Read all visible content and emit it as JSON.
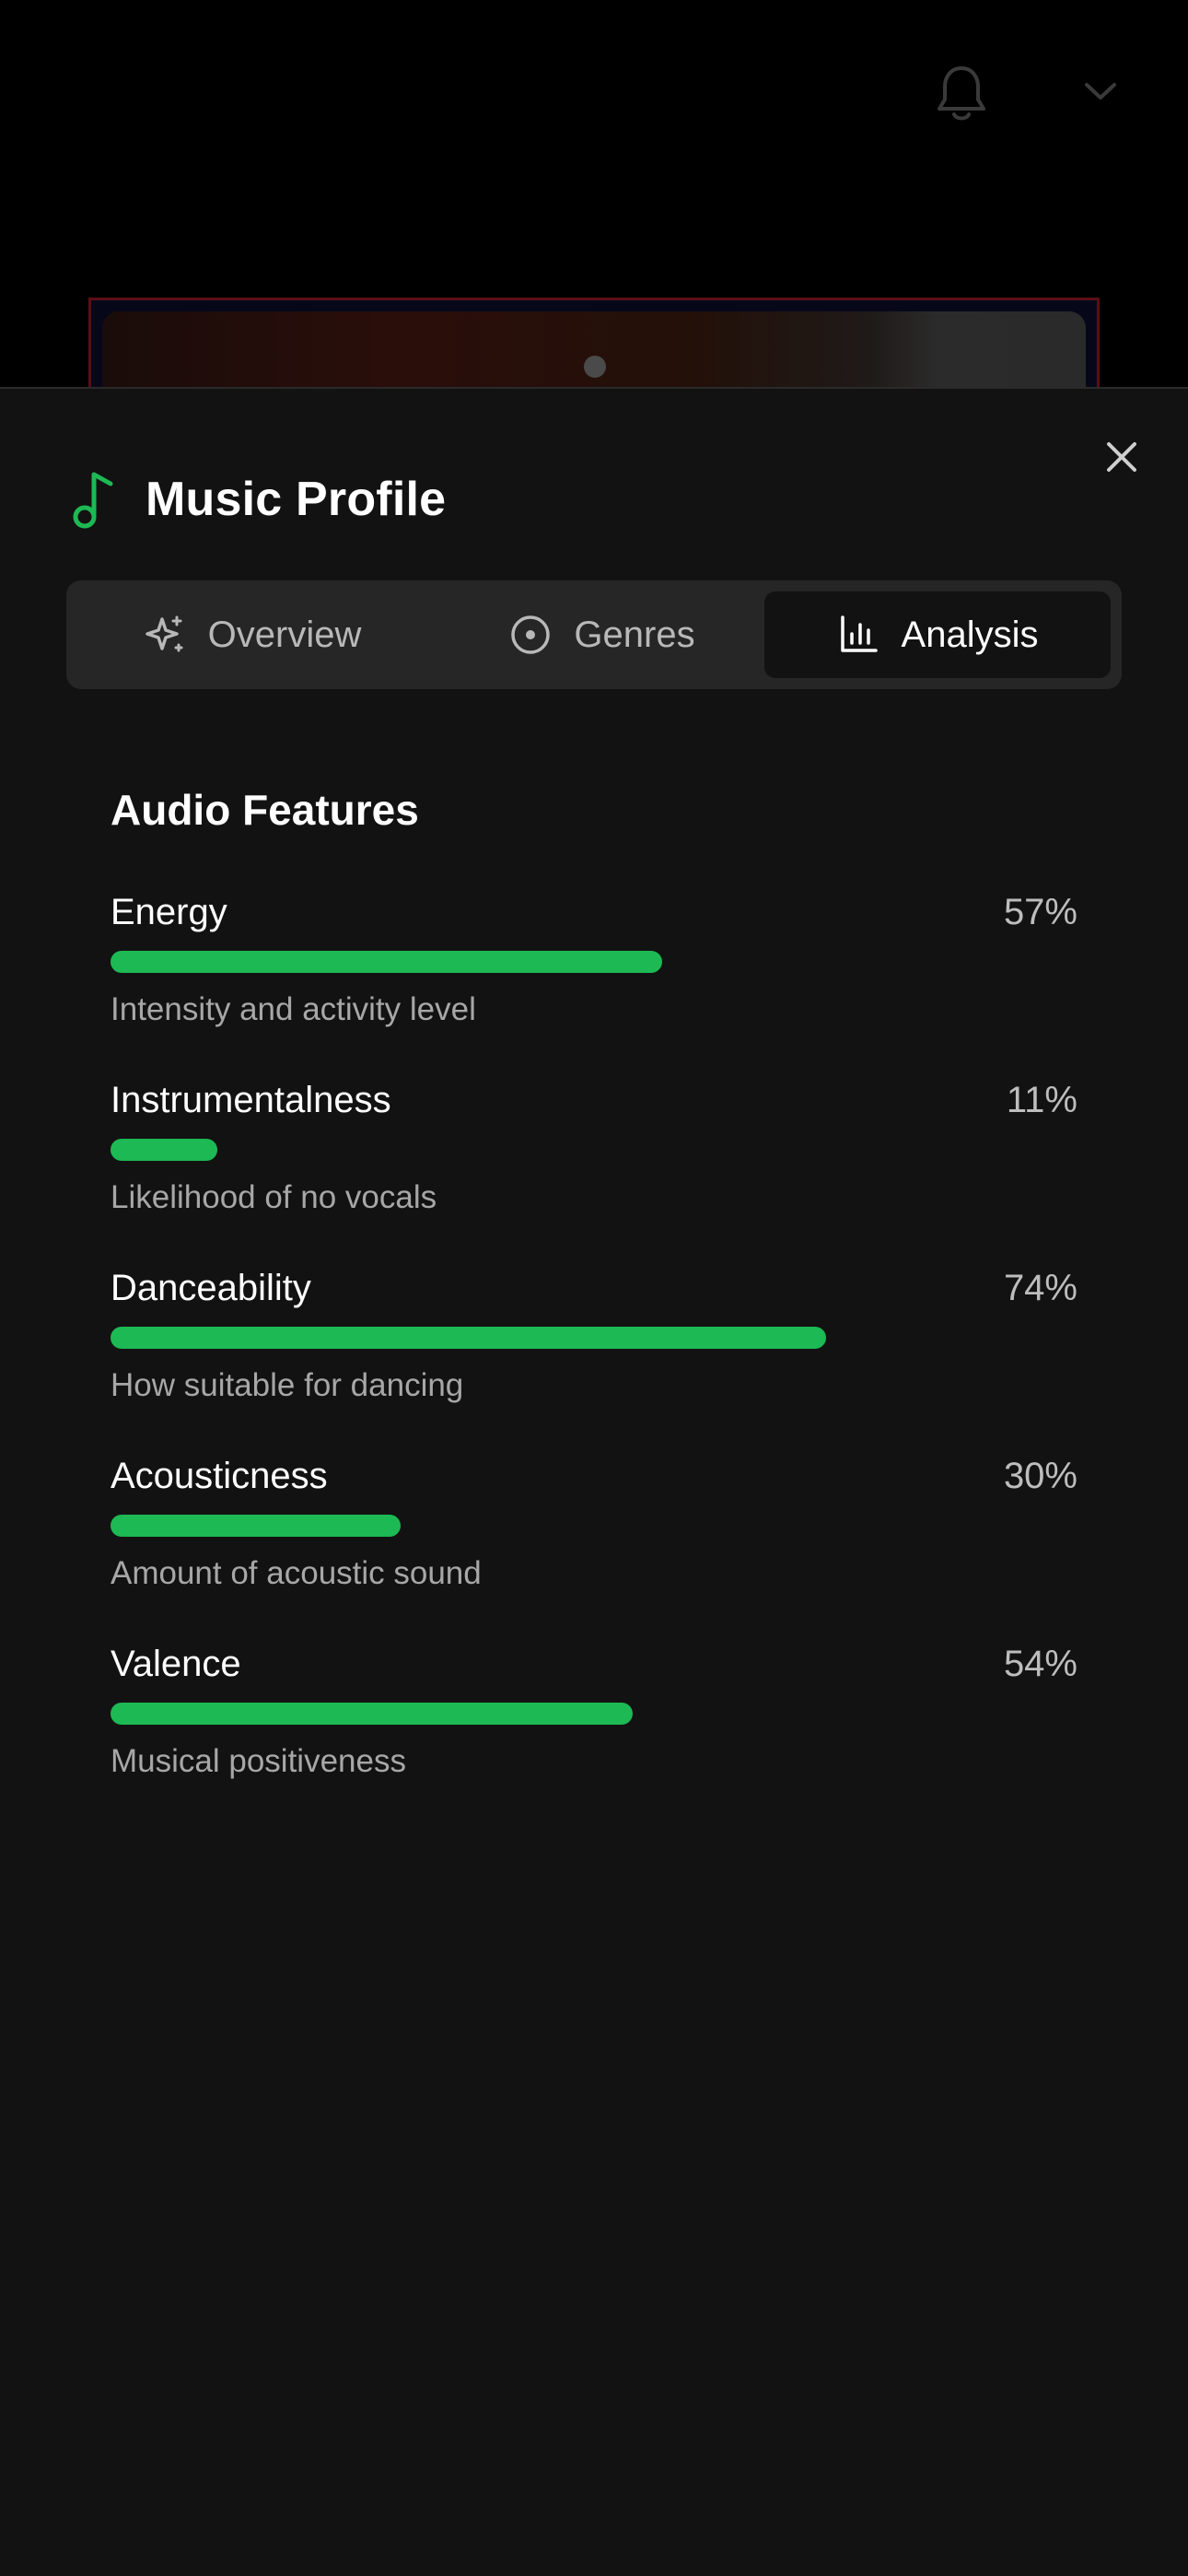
{
  "colors": {
    "accent": "#1db954",
    "sheet_background": "#121212",
    "tab_bar_background": "#262626",
    "text_primary": "#ffffff",
    "text_secondary": "#a7a7a7"
  },
  "topbar": {
    "notification_icon": "bell-icon",
    "menu_icon": "chevron-down-icon"
  },
  "sheet": {
    "title": "Music Profile",
    "title_icon": "music-note-icon",
    "close_icon": "close-icon",
    "tabs": [
      {
        "label": "Overview",
        "icon": "sparkles-icon",
        "active": false
      },
      {
        "label": "Genres",
        "icon": "disc-icon",
        "active": false
      },
      {
        "label": "Analysis",
        "icon": "bar-chart-icon",
        "active": true
      }
    ]
  },
  "audio_features": {
    "title": "Audio Features",
    "items": [
      {
        "name": "Energy",
        "percent_label": "57%",
        "value": 0.57,
        "description": "Intensity and activity level"
      },
      {
        "name": "Instrumentalness",
        "percent_label": "11%",
        "value": 0.11,
        "description": "Likelihood of no vocals"
      },
      {
        "name": "Danceability",
        "percent_label": "74%",
        "value": 0.74,
        "description": "How suitable for dancing"
      },
      {
        "name": "Acousticness",
        "percent_label": "30%",
        "value": 0.3,
        "description": "Amount of acoustic sound"
      },
      {
        "name": "Valence",
        "percent_label": "54%",
        "value": 0.54,
        "description": "Musical positiveness"
      }
    ]
  }
}
